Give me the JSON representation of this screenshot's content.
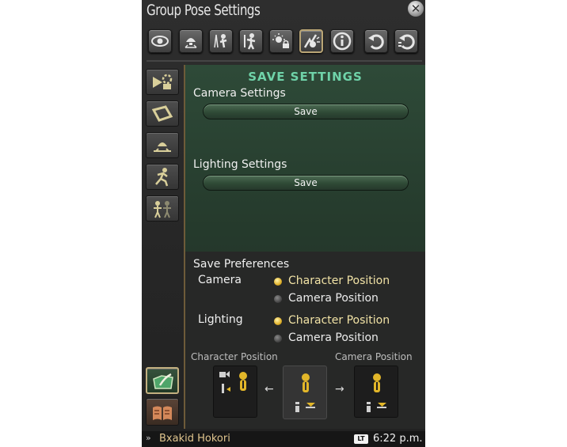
{
  "window": {
    "title": "Group Pose Settings",
    "close_icon": "close-icon"
  },
  "toolbar": {
    "buttons": [
      {
        "icon": "eye-icon"
      },
      {
        "icon": "lamp-icon"
      },
      {
        "icon": "character-tree-icon"
      },
      {
        "icon": "character-pose-icon"
      },
      {
        "icon": "lighting-lock-icon"
      },
      {
        "icon": "effects-icon",
        "active": true
      },
      {
        "icon": "info-icon"
      },
      {
        "icon": "reset-icon"
      },
      {
        "icon": "reset-all-icon"
      }
    ]
  },
  "sidebar": {
    "items": [
      {
        "icon": "camera-settings-icon"
      },
      {
        "icon": "frame-icon"
      },
      {
        "icon": "lighting-icon"
      },
      {
        "icon": "motion-icon"
      },
      {
        "icon": "group-icon"
      }
    ],
    "bottom": [
      {
        "icon": "save-settings-icon",
        "active": true
      },
      {
        "icon": "book-icon"
      }
    ]
  },
  "main": {
    "heading": "SAVE SETTINGS",
    "camera_settings": {
      "label": "Camera Settings",
      "button": "Save"
    },
    "lighting_settings": {
      "label": "Lighting Settings",
      "button": "Save"
    },
    "preferences": {
      "label": "Save Preferences",
      "camera": {
        "label": "Camera",
        "options": [
          "Character Position",
          "Camera Position"
        ],
        "selected": "Character Position"
      },
      "lighting": {
        "label": "Lighting",
        "options": [
          "Character Position",
          "Camera Position"
        ],
        "selected": "Character Position"
      }
    },
    "diagram": {
      "left_label": "Character Position",
      "right_label": "Camera Position",
      "left_arrow": "←",
      "right_arrow": "→"
    }
  },
  "status_bar": {
    "character": "Bxakid Hokori",
    "button_hint": "LT",
    "time": "6:22 p.m."
  },
  "colors": {
    "accent": "#6fd3a9",
    "highlight": "#e0b12a",
    "border": "#b9a575"
  }
}
